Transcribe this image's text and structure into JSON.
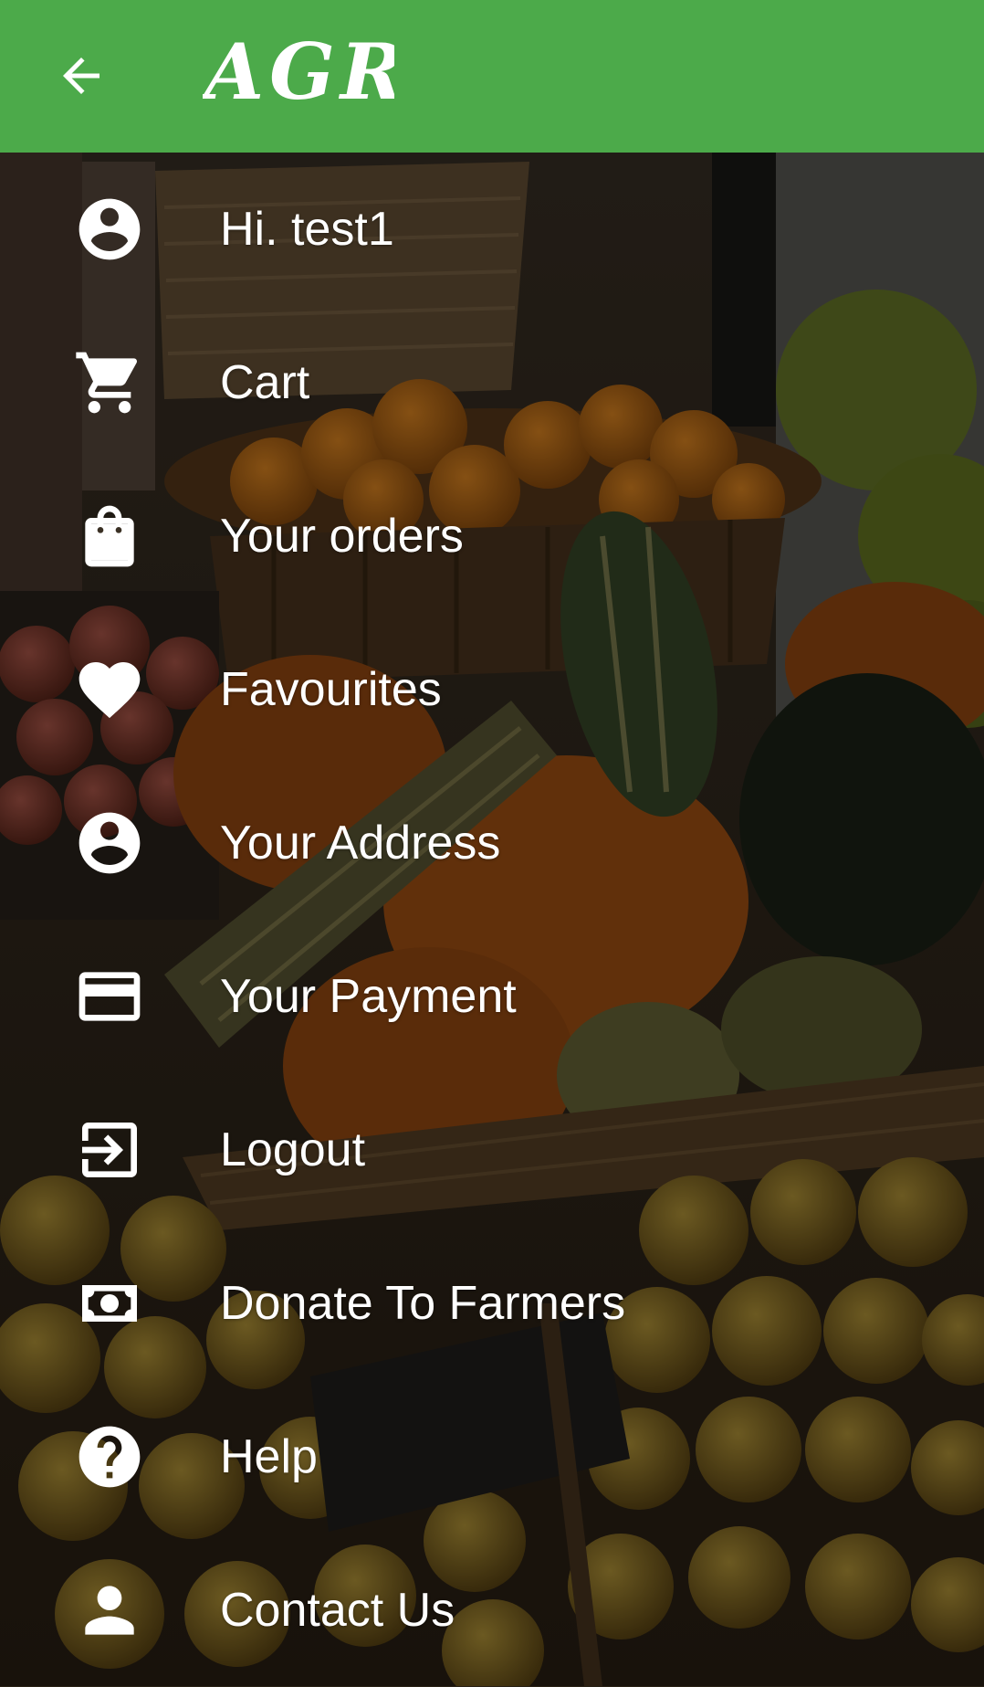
{
  "app_bar": {
    "title": "AGRI",
    "color": "#4caa4a"
  },
  "menu": {
    "items": [
      {
        "label": "Hi. test1",
        "icon": "account-circle-icon"
      },
      {
        "label": "Cart",
        "icon": "cart-icon"
      },
      {
        "label": "Your orders",
        "icon": "shopping-bag-icon"
      },
      {
        "label": "Favourites",
        "icon": "heart-icon"
      },
      {
        "label": "Your Address",
        "icon": "account-circle-icon"
      },
      {
        "label": "Your Payment",
        "icon": "credit-card-icon"
      },
      {
        "label": "Logout",
        "icon": "exit-to-app-icon"
      },
      {
        "label": "Donate To Farmers",
        "icon": "cash-icon"
      },
      {
        "label": "Help",
        "icon": "help-circle-icon"
      },
      {
        "label": "Contact Us",
        "icon": "person-icon"
      }
    ]
  }
}
